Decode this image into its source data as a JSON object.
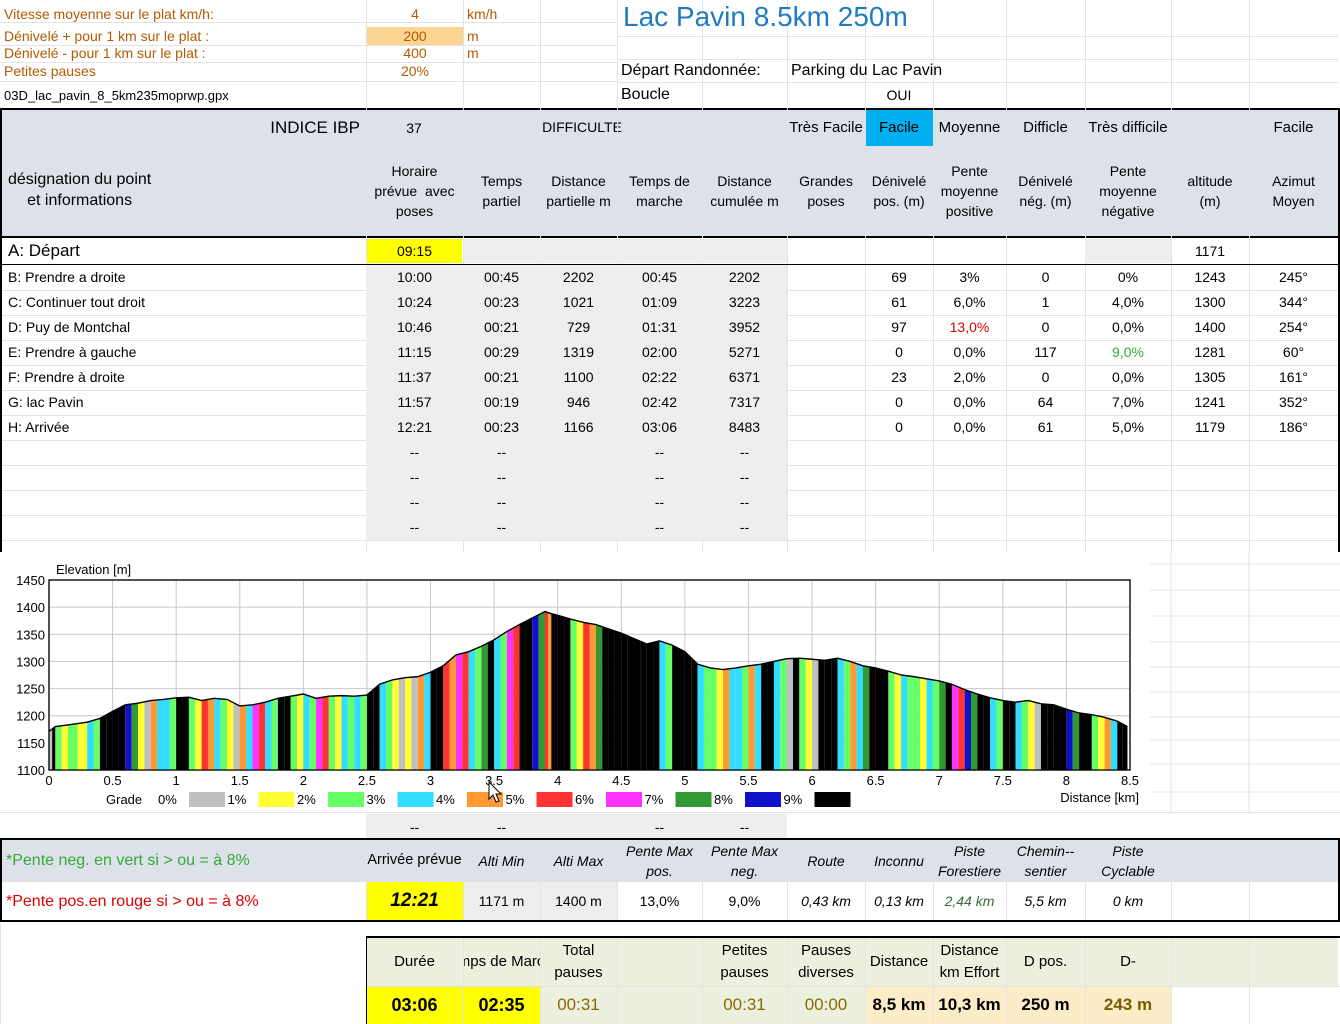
{
  "sheet": {
    "params": [
      {
        "label": "Vitesse moyenne sur le plat  km/h:",
        "value": "4",
        "unit": "km/h"
      },
      {
        "label": "Dénivelé + pour 1 km sur le plat :",
        "value": "200",
        "unit": "m"
      },
      {
        "label": "Dénivelé - pour 1 km sur le plat :",
        "value": "400",
        "unit": "m"
      },
      {
        "label": "Petites pauses",
        "value": "20%",
        "unit": ""
      }
    ],
    "filename": "03D_lac_pavin_8_5km235moprwp.gpx",
    "title": "Lac Pavin 8.5km 250m",
    "depart_label": "Départ Randonnée:",
    "depart_value": "Parking du Lac Pavin",
    "boucle_label": "Boucle",
    "boucle_value": "OUI"
  },
  "ibp": {
    "label": "INDICE IBP",
    "value": "37",
    "difficulte_label": "DIFFICULTE",
    "levels": [
      "Très Facile",
      "Facile",
      "Moyenne",
      "Difficle",
      "Très difficile"
    ],
    "active_level": "Facile",
    "active_color": "#00b0f0",
    "azimut_level": "Facile"
  },
  "columns": [
    "désignation du point\net informations",
    "Horaire\nprévue  avec\nposes",
    "Temps\npartiel",
    "Distance\npartielle m",
    "Temps de\nmarche",
    "Distance\ncumulée m",
    "Grandes\nposes",
    "Dénivelé\npos. (m)",
    "Pente\nmoyenne\npositive",
    "Dénivelé\nnég. (m)",
    "Pente\nmoyenne\nnégative",
    "altitude\n(m)",
    "Azimut\nMoyen"
  ],
  "star": "*",
  "start_row": {
    "name": "A: Départ",
    "time": "09:15",
    "altitude": "1171"
  },
  "rows": [
    {
      "name": "B: Prendre a droite",
      "time": "10:00",
      "tp": "00:45",
      "dp": "2202",
      "tm": "00:45",
      "dc": "2202",
      "dpos": "69",
      "ppos": "3%",
      "dneg": "0",
      "pneg": "0%",
      "alt": "1243",
      "az": "245°"
    },
    {
      "name": "C: Continuer tout droit",
      "time": "10:24",
      "tp": "00:23",
      "dp": "1021",
      "tm": "01:09",
      "dc": "3223",
      "dpos": "61",
      "ppos": "6,0%",
      "dneg": "1",
      "pneg": "4,0%",
      "alt": "1300",
      "az": "344°"
    },
    {
      "name": "D: Puy de Montchal",
      "time": "10:46",
      "tp": "00:21",
      "dp": "729",
      "tm": "01:31",
      "dc": "3952",
      "dpos": "97",
      "ppos": "13,0%",
      "dneg": "0",
      "pneg": "0,0%",
      "alt": "1400",
      "az": "254°"
    },
    {
      "name": "E: Prendre à gauche",
      "time": "11:15",
      "tp": "00:29",
      "dp": "1319",
      "tm": "02:00",
      "dc": "5271",
      "dpos": "0",
      "ppos": "0,0%",
      "dneg": "117",
      "pneg": "9,0%",
      "alt": "1281",
      "az": "60°"
    },
    {
      "name": "F: Prendre à droite",
      "time": "11:37",
      "tp": "00:21",
      "dp": "1100",
      "tm": "02:22",
      "dc": "6371",
      "dpos": "23",
      "ppos": "2,0%",
      "dneg": "0",
      "pneg": "0,0%",
      "alt": "1305",
      "az": "161°"
    },
    {
      "name": "G: lac Pavin",
      "time": "11:57",
      "tp": "00:19",
      "dp": "946",
      "tm": "02:42",
      "dc": "7317",
      "dpos": "0",
      "ppos": "0,0%",
      "dneg": "64",
      "pneg": "7,0%",
      "alt": "1241",
      "az": "352°"
    },
    {
      "name": "H: Arrivée",
      "time": "12:21",
      "tp": "00:23",
      "dp": "1166",
      "tm": "03:06",
      "dc": "8483",
      "dpos": "0",
      "ppos": "0,0%",
      "dneg": "61",
      "pneg": "5,0%",
      "alt": "1179",
      "az": "186°"
    }
  ],
  "dash": "--",
  "notes": {
    "neg": "*Pente neg. en vert si > ou = à 8%",
    "pos": "*Pente pos.en rouge si > ou = à 8%"
  },
  "summary": {
    "headers": [
      "Arrivée prévue",
      "Alti Min",
      "Alti Max",
      "Pente Max\npos.",
      "Pente Max\nneg.",
      "Route",
      "Inconnu",
      "Piste\nForestiere",
      "Chemin--\nsentier",
      "Piste\nCyclable"
    ],
    "values": [
      "12:21",
      "1171 m",
      "1400 m",
      "13,0%",
      "9,0%",
      "0,43 km",
      "0,13 km",
      "2,44 km",
      "5,5 km",
      "0 km"
    ]
  },
  "totals": {
    "headers": [
      "Durée",
      "Temps de Marche",
      "Total\npauses",
      "",
      "Petites\npauses",
      "Pauses\ndiverses",
      "Distance",
      "Distance\nkm Effort",
      "D pos.",
      "D-"
    ],
    "values": [
      "03:06",
      "02:35",
      "00:31",
      "",
      "00:31",
      "00:00",
      "8,5 km",
      "10,3 km",
      "250 m",
      "243 m"
    ]
  },
  "colors": {
    "grade": [
      "#c0c0c0",
      "#ffff33",
      "#66ff66",
      "#33ddff",
      "#ff9933",
      "#ff3333",
      "#ff33ff",
      "#339933",
      "#1111cc",
      "#000000"
    ],
    "red_text": "#e00000",
    "green_text": "#33aa33",
    "yellow": "#ffff00",
    "param_orange": "#fbd591",
    "title_blue": "#1f7cc1",
    "totals_green": "#ebf1de",
    "header_blue": "#dde2ea",
    "row_gray": "#eeeeee"
  },
  "chart_data": {
    "type": "area",
    "ylabel": "Elevation [m]",
    "xlabel": "Distance [km]",
    "ylim": [
      1100,
      1450
    ],
    "xlim": [
      0,
      8.5
    ],
    "y_ticks": [
      "1100",
      "1150",
      "1200",
      "1250",
      "1300",
      "1350",
      "1400",
      "1450"
    ],
    "x_ticks": [
      "0",
      "0.5",
      "1",
      "1.5",
      "2",
      "2.5",
      "3",
      "3.5",
      "4",
      "4.5",
      "5",
      "5.5",
      "6",
      "6.5",
      "7",
      "7.5",
      "8",
      "8.5"
    ],
    "grid": true,
    "legend_title": "Grade",
    "legend": [
      "0%",
      "1%",
      "2%",
      "3%",
      "4%",
      "5%",
      "6%",
      "7%",
      "8%",
      "9%"
    ],
    "x": [
      0,
      0.05,
      0.15,
      0.3,
      0.4,
      0.5,
      0.6,
      0.7,
      0.8,
      0.9,
      1.0,
      1.1,
      1.2,
      1.3,
      1.4,
      1.5,
      1.6,
      1.7,
      1.8,
      1.9,
      2.0,
      2.1,
      2.2,
      2.3,
      2.4,
      2.5,
      2.6,
      2.7,
      2.8,
      2.9,
      3.0,
      3.1,
      3.2,
      3.3,
      3.4,
      3.5,
      3.6,
      3.7,
      3.8,
      3.9,
      3.95,
      4.0,
      4.1,
      4.2,
      4.3,
      4.4,
      4.5,
      4.6,
      4.7,
      4.8,
      4.9,
      5.0,
      5.1,
      5.2,
      5.3,
      5.4,
      5.5,
      5.6,
      5.7,
      5.8,
      5.9,
      6.0,
      6.1,
      6.2,
      6.3,
      6.4,
      6.5,
      6.6,
      6.7,
      6.8,
      6.9,
      7.0,
      7.1,
      7.2,
      7.3,
      7.4,
      7.5,
      7.6,
      7.7,
      7.8,
      7.9,
      8.0,
      8.1,
      8.2,
      8.3,
      8.4,
      8.48
    ],
    "y": [
      1171,
      1180,
      1183,
      1188,
      1195,
      1208,
      1220,
      1223,
      1228,
      1230,
      1233,
      1234,
      1228,
      1232,
      1230,
      1218,
      1220,
      1225,
      1232,
      1236,
      1240,
      1232,
      1236,
      1237,
      1236,
      1238,
      1258,
      1266,
      1270,
      1272,
      1280,
      1292,
      1312,
      1318,
      1328,
      1340,
      1355,
      1368,
      1380,
      1392,
      1388,
      1385,
      1378,
      1372,
      1368,
      1360,
      1352,
      1342,
      1332,
      1338,
      1330,
      1318,
      1295,
      1288,
      1285,
      1288,
      1292,
      1295,
      1300,
      1305,
      1306,
      1304,
      1302,
      1306,
      1300,
      1292,
      1288,
      1282,
      1275,
      1272,
      1268,
      1264,
      1258,
      1248,
      1240,
      1233,
      1228,
      1225,
      1228,
      1222,
      1220,
      1212,
      1205,
      1202,
      1197,
      1190,
      1180
    ],
    "grade_index": [
      0,
      2,
      2,
      3,
      9,
      9,
      8,
      1,
      4,
      3,
      9,
      2,
      5,
      3,
      1,
      4,
      6,
      3,
      9,
      2,
      3,
      6,
      2,
      3,
      3,
      9,
      3,
      1,
      1,
      4,
      9,
      5,
      6,
      3,
      7,
      3,
      6,
      9,
      8,
      5,
      9,
      9,
      2,
      5,
      7,
      9,
      9,
      9,
      9,
      3,
      9,
      9,
      3,
      2,
      4,
      3,
      4,
      9,
      3,
      0,
      2,
      0,
      9,
      3,
      4,
      7,
      9,
      2,
      3,
      2,
      3,
      7,
      6,
      8,
      9,
      3,
      9,
      3,
      1,
      9,
      9,
      8,
      9,
      2,
      4,
      9,
      9
    ]
  }
}
